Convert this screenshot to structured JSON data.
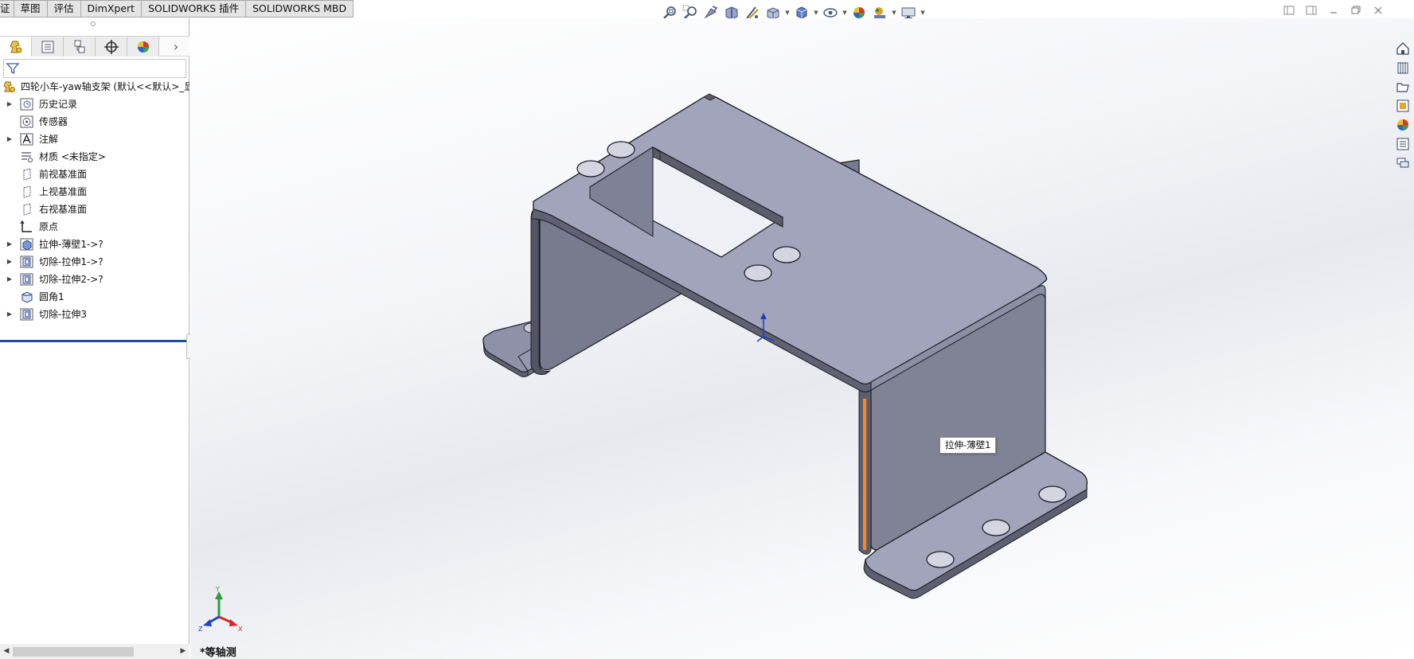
{
  "ribbon": {
    "tabs": [
      "证",
      "草图",
      "评估",
      "DimXpert",
      "SOLIDWORKS 插件",
      "SOLIDWORKS MBD"
    ]
  },
  "hud": {
    "icons": [
      "zoom-to-fit-icon",
      "zoom-to-area-icon",
      "previous-view-icon",
      "section-view-icon",
      "dynamic-annotation-icon",
      "view-orientation-icon",
      "display-style-icon",
      "hide-show-items-icon",
      "edit-appearance-icon",
      "apply-scene-icon",
      "view-settings-icon"
    ]
  },
  "feature_tree": {
    "filter_placeholder": "",
    "root_label": "四轮小车-yaw轴支架  (默认<<默认>_显",
    "items": [
      {
        "label": "历史记录",
        "icon": "history-icon",
        "expandable": true
      },
      {
        "label": "传感器",
        "icon": "sensor-icon",
        "expandable": false
      },
      {
        "label": "注解",
        "icon": "annotation-icon",
        "expandable": true
      },
      {
        "label": "材质 <未指定>",
        "icon": "material-icon",
        "expandable": false
      },
      {
        "label": "前视基准面",
        "icon": "plane-icon",
        "expandable": false
      },
      {
        "label": "上视基准面",
        "icon": "plane-icon",
        "expandable": false
      },
      {
        "label": "右视基准面",
        "icon": "plane-icon",
        "expandable": false
      },
      {
        "label": "原点",
        "icon": "origin-icon",
        "expandable": false
      },
      {
        "label": "拉伸-薄壁1->?",
        "icon": "extrude-icon",
        "expandable": true
      },
      {
        "label": "切除-拉伸1->?",
        "icon": "cut-extrude-icon",
        "expandable": true
      },
      {
        "label": "切除-拉伸2->?",
        "icon": "cut-extrude-icon",
        "expandable": true
      },
      {
        "label": "圆角1",
        "icon": "fillet-icon",
        "expandable": false
      },
      {
        "label": "切除-拉伸3",
        "icon": "cut-extrude-icon",
        "expandable": true
      }
    ]
  },
  "viewport": {
    "tooltip": "拉伸-薄壁1",
    "view_name": "*等轴测",
    "triad_labels": {
      "x": "X",
      "y": "Y",
      "z": "Z"
    }
  },
  "colors": {
    "model_top": "#a1a4bb",
    "model_side": "#808395",
    "model_dark": "#5a5c6a",
    "selection": "#ff8a1a",
    "rollback_bar": "#1d4ea0"
  }
}
